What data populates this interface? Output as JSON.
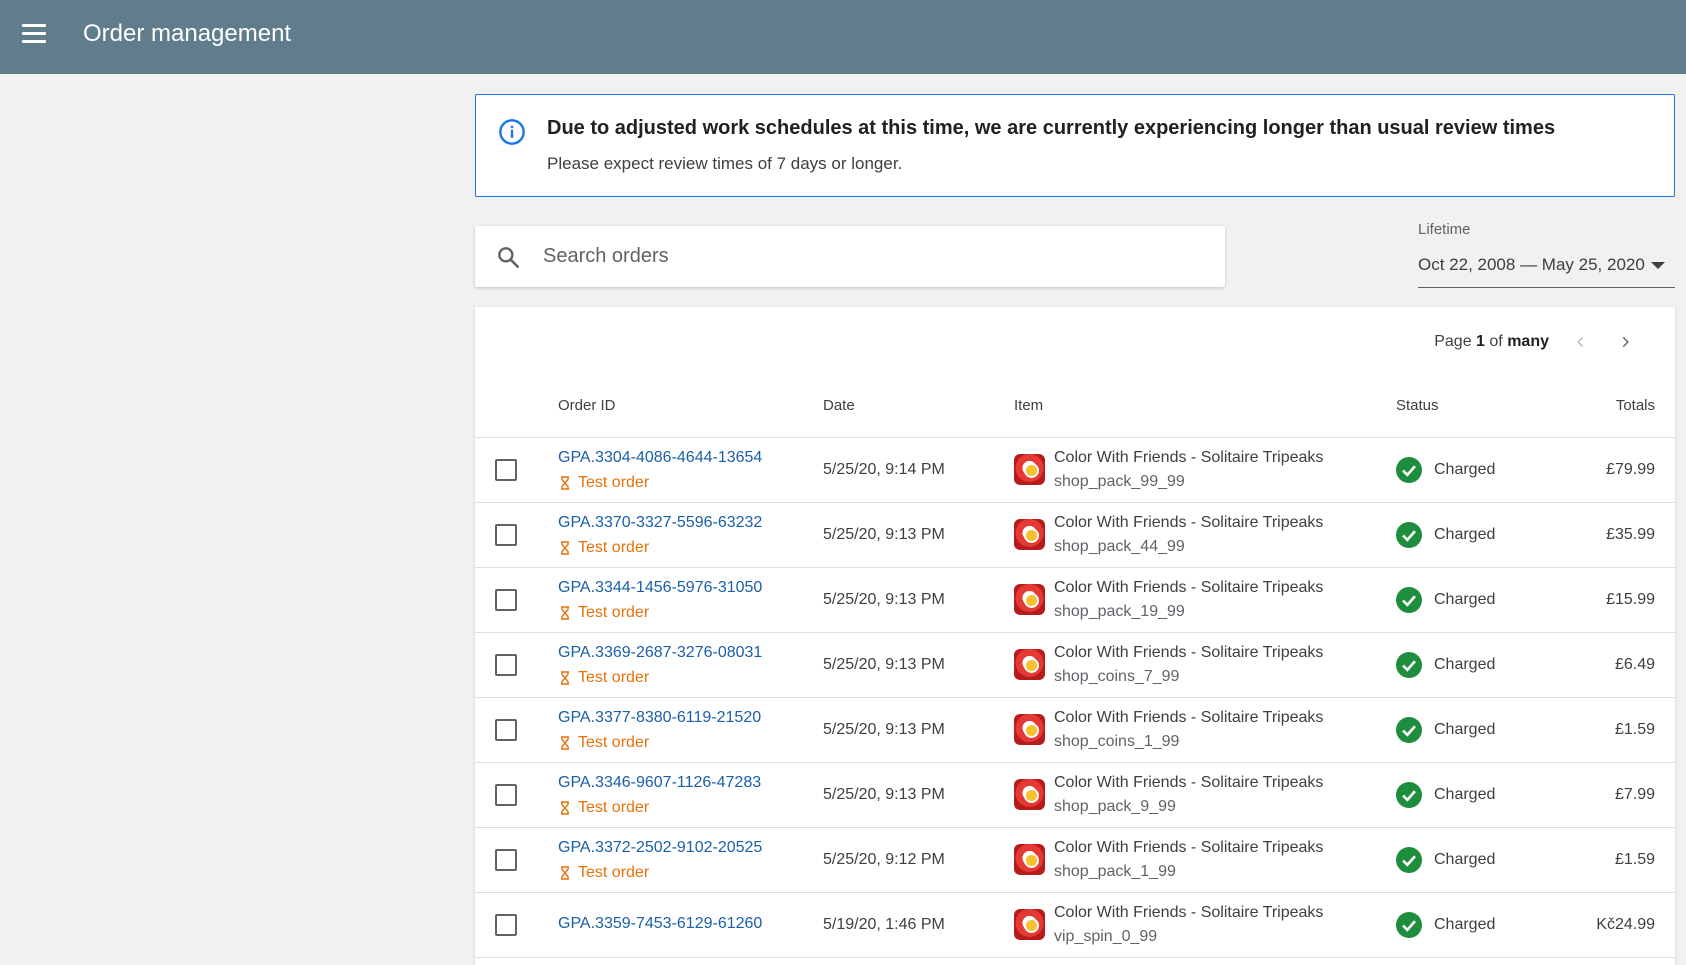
{
  "header": {
    "title": "Order management"
  },
  "banner": {
    "title": "Due to adjusted work schedules at this time, we are currently experiencing longer than usual review times",
    "subtitle": "Please expect review times of 7 days or longer."
  },
  "search": {
    "placeholder": "Search orders"
  },
  "date_filter": {
    "label": "Lifetime",
    "value": "Oct 22, 2008 — May 25, 2020"
  },
  "pager": {
    "prefix": "Page",
    "page": "1",
    "of": "of",
    "total": "many"
  },
  "table": {
    "columns": {
      "order_id": "Order ID",
      "date": "Date",
      "item": "Item",
      "status": "Status",
      "totals": "Totals"
    },
    "rows": [
      {
        "order_id": "GPA.3304-4086-4644-13654",
        "test": "Test order",
        "date": "5/25/20, 9:14 PM",
        "item": "Color With Friends - Solitaire Tripeaks",
        "sku": "shop_pack_99_99",
        "status": "Charged",
        "total": "£79.99"
      },
      {
        "order_id": "GPA.3370-3327-5596-63232",
        "test": "Test order",
        "date": "5/25/20, 9:13 PM",
        "item": "Color With Friends - Solitaire Tripeaks",
        "sku": "shop_pack_44_99",
        "status": "Charged",
        "total": "£35.99"
      },
      {
        "order_id": "GPA.3344-1456-5976-31050",
        "test": "Test order",
        "date": "5/25/20, 9:13 PM",
        "item": "Color With Friends - Solitaire Tripeaks",
        "sku": "shop_pack_19_99",
        "status": "Charged",
        "total": "£15.99"
      },
      {
        "order_id": "GPA.3369-2687-3276-08031",
        "test": "Test order",
        "date": "5/25/20, 9:13 PM",
        "item": "Color With Friends - Solitaire Tripeaks",
        "sku": "shop_coins_7_99",
        "status": "Charged",
        "total": "£6.49"
      },
      {
        "order_id": "GPA.3377-8380-6119-21520",
        "test": "Test order",
        "date": "5/25/20, 9:13 PM",
        "item": "Color With Friends - Solitaire Tripeaks",
        "sku": "shop_coins_1_99",
        "status": "Charged",
        "total": "£1.59"
      },
      {
        "order_id": "GPA.3346-9607-1126-47283",
        "test": "Test order",
        "date": "5/25/20, 9:13 PM",
        "item": "Color With Friends - Solitaire Tripeaks",
        "sku": "shop_pack_9_99",
        "status": "Charged",
        "total": "£7.99"
      },
      {
        "order_id": "GPA.3372-2502-9102-20525",
        "test": "Test order",
        "date": "5/25/20, 9:12 PM",
        "item": "Color With Friends - Solitaire Tripeaks",
        "sku": "shop_pack_1_99",
        "status": "Charged",
        "total": "£1.59"
      },
      {
        "order_id": "GPA.3359-7453-6129-61260",
        "test": "",
        "date": "5/19/20, 1:46 PM",
        "item": "Color With Friends - Solitaire Tripeaks",
        "sku": "vip_spin_0_99",
        "status": "Charged",
        "total": "Kč24.99"
      }
    ]
  },
  "colors": {
    "header_bg": "#607d8b",
    "accent": "#1a73e8",
    "link": "#1a5fa8",
    "test": "#e8710a",
    "charged": "#1e8e3e"
  },
  "icons": {
    "menu": "menu-icon",
    "info": "info-icon",
    "search": "search-icon",
    "status": "check-circle-icon",
    "test": "hourglass-icon"
  }
}
